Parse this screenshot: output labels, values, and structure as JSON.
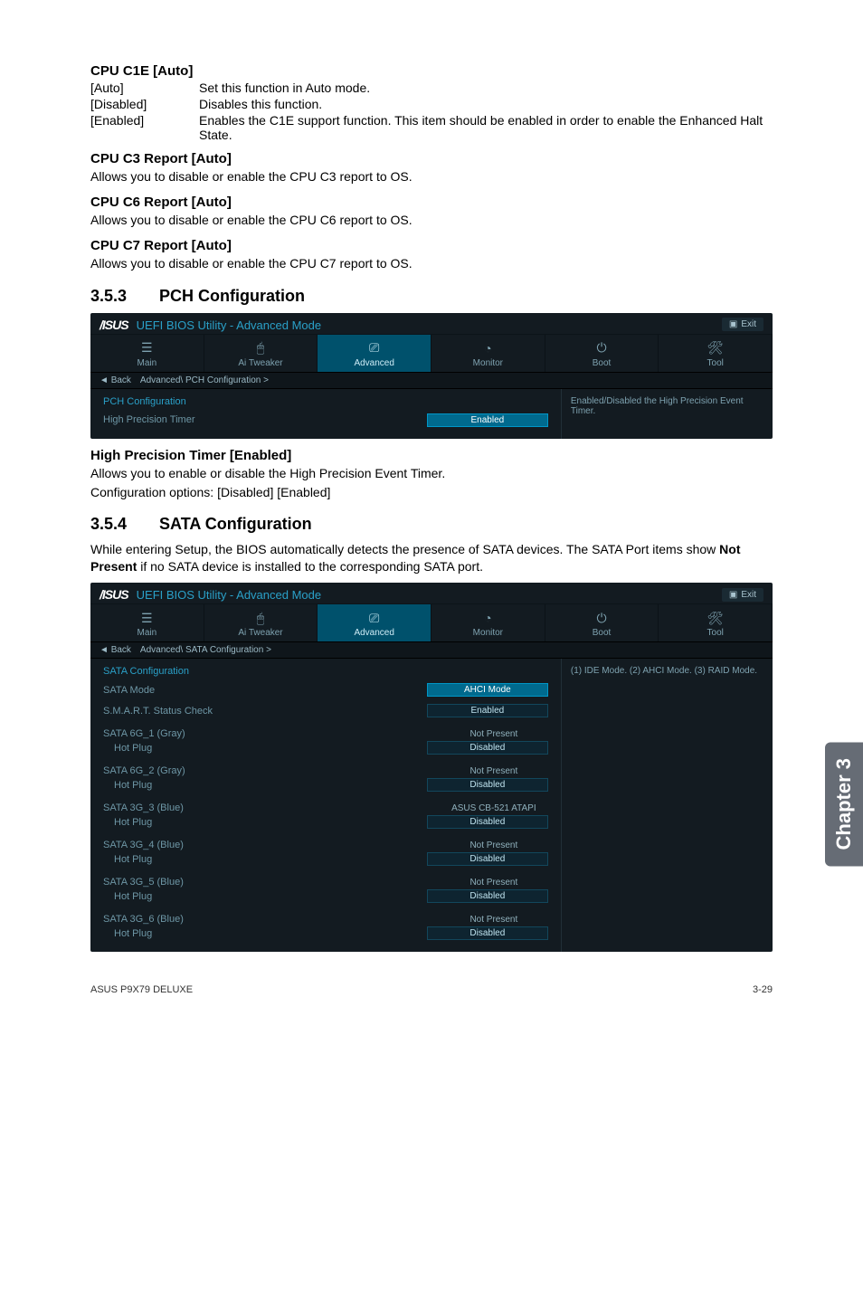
{
  "sections": {
    "c1e": {
      "title": "CPU C1E [Auto]",
      "items": [
        {
          "k": "[Auto]",
          "v": "Set this function in Auto mode."
        },
        {
          "k": "[Disabled]",
          "v": "Disables this function."
        },
        {
          "k": "[Enabled]",
          "v": "Enables the C1E support function. This item should be enabled in order to enable the Enhanced Halt State."
        }
      ]
    },
    "c3": {
      "title": "CPU C3 Report [Auto]",
      "body": "Allows you to disable or enable the CPU C3 report to OS."
    },
    "c6": {
      "title": "CPU C6 Report [Auto]",
      "body": "Allows you to disable or enable the CPU C6 report to OS."
    },
    "c7": {
      "title": "CPU C7 Report [Auto]",
      "body": "Allows you to disable or enable the CPU C7 report to OS."
    },
    "pch_num": "3.5.3  PCH Configuration",
    "hpt": {
      "title": "High Precision Timer [Enabled]",
      "body1": "Allows you to enable or disable the High Precision Event Timer.",
      "body2": "Configuration options: [Disabled] [Enabled]"
    },
    "sata_num": "3.5.4  SATA Configuration",
    "sata_intro_a": "While entering Setup, the BIOS automatically detects the presence of SATA devices. The SATA Port items show ",
    "sata_intro_bold": "Not Present",
    "sata_intro_b": " if no SATA device is installed to the corresponding SATA port."
  },
  "bios": {
    "logo": "/ISUS",
    "modetitle": "UEFI BIOS Utility - Advanced Mode",
    "exit": "Exit",
    "tabs": [
      "Main",
      "Ai  Tweaker",
      "Advanced",
      "Monitor",
      "Boot",
      "Tool"
    ],
    "back": "Back",
    "pch": {
      "crumb": "Advanced\\  PCH Configuration  >",
      "heading": "PCH Configuration",
      "row_label": "High Precision Timer",
      "row_value": "Enabled",
      "help": "Enabled/Disabled the High Precision Event Timer."
    },
    "sata": {
      "crumb": "Advanced\\  SATA Configuration  >",
      "heading": "SATA Configuration",
      "help": "(1) IDE Mode. (2) AHCI Mode. (3) RAID Mode.",
      "rows_top": [
        {
          "name": "SATA Mode",
          "value": "AHCI Mode",
          "sel": true
        },
        {
          "name": "S.M.A.R.T. Status Check",
          "value": "Enabled",
          "sel": false
        }
      ],
      "ports": [
        {
          "name": "SATA 6G_1 (Gray)",
          "status": "Not Present",
          "hot": "Disabled"
        },
        {
          "name": "SATA 6G_2 (Gray)",
          "status": "Not Present",
          "hot": "Disabled"
        },
        {
          "name": "SATA 3G_3 (Blue)",
          "status": "ASUS   CB-521 ATAPI",
          "hot": "Disabled"
        },
        {
          "name": "SATA 3G_4 (Blue)",
          "status": "Not Present",
          "hot": "Disabled"
        },
        {
          "name": "SATA 3G_5 (Blue)",
          "status": "Not Present",
          "hot": "Disabled"
        },
        {
          "name": "SATA 3G_6 (Blue)",
          "status": "Not Present",
          "hot": "Disabled"
        }
      ],
      "hotplug_label": "Hot Plug"
    }
  },
  "side_tab": "Chapter 3",
  "footer": {
    "left": "ASUS P9X79 DELUXE",
    "right": "3-29"
  }
}
